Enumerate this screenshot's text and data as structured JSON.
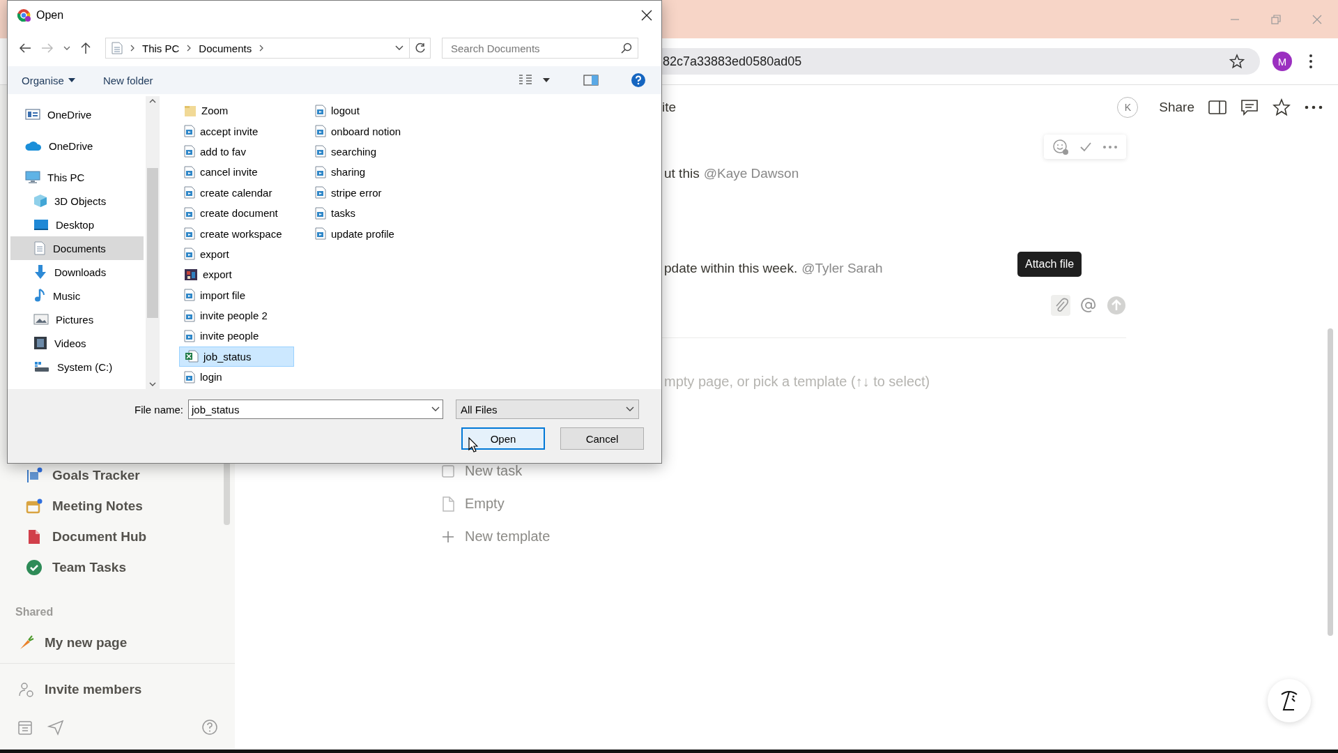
{
  "browser": {
    "address": "82c7a33883ed0580ad05",
    "profile_initial": "M"
  },
  "sidebar": {
    "items": [
      {
        "label": "Goals Tracker",
        "kind": "chart"
      },
      {
        "label": "Meeting Notes",
        "kind": "calendar"
      },
      {
        "label": "Document Hub",
        "kind": "document"
      },
      {
        "label": "Team Tasks",
        "kind": "check"
      }
    ],
    "section_label": "Shared",
    "shared_items": [
      {
        "label": "My new page",
        "kind": "carrot"
      }
    ],
    "invite": "Invite members"
  },
  "page": {
    "title": "ite",
    "avatar_initial": "K",
    "share": "Share",
    "comments": [
      {
        "text": "ut this",
        "mention": "@Kaye Dawson"
      },
      {
        "text": "pdate within this week.",
        "mention": "@Tyler Sarah"
      }
    ],
    "tooltip": "Attach file",
    "prompt": "mpty page, or pick a template (↑↓ to select)",
    "templates": [
      {
        "label": "New task",
        "kind": "task"
      },
      {
        "label": "Empty",
        "kind": "page"
      },
      {
        "label": "New template",
        "kind": "add"
      }
    ]
  },
  "dialog": {
    "title": "Open",
    "path": [
      "This PC",
      "Documents"
    ],
    "search_placeholder": "Search Documents",
    "commands": [
      {
        "label": "Organise",
        "kind": "menu"
      },
      {
        "label": "New folder",
        "kind": "plain"
      }
    ],
    "nav": [
      {
        "label": "OneDrive",
        "kind": "onedrive-business",
        "selected": false
      },
      {
        "label": "OneDrive",
        "kind": "cloud",
        "selected": false
      },
      {
        "label": "This PC",
        "kind": "pc",
        "selected": false,
        "children": [
          {
            "label": "3D Objects",
            "kind": "cube",
            "selected": false
          },
          {
            "label": "Desktop",
            "kind": "desktop",
            "selected": false
          },
          {
            "label": "Documents",
            "kind": "documents",
            "selected": true
          },
          {
            "label": "Downloads",
            "kind": "download",
            "selected": false
          },
          {
            "label": "Music",
            "kind": "music",
            "selected": false
          },
          {
            "label": "Pictures",
            "kind": "pictures",
            "selected": false
          },
          {
            "label": "Videos",
            "kind": "videos",
            "selected": false
          },
          {
            "label": "System (C:)",
            "kind": "drive",
            "selected": false
          }
        ]
      }
    ],
    "files": [
      {
        "name": "Zoom",
        "kind": "folder",
        "selected": false
      },
      {
        "name": "accept invite",
        "kind": "video",
        "selected": false
      },
      {
        "name": "add to fav",
        "kind": "video",
        "selected": false
      },
      {
        "name": "cancel invite",
        "kind": "video",
        "selected": false
      },
      {
        "name": "create calendar",
        "kind": "video",
        "selected": false
      },
      {
        "name": "create document",
        "kind": "video",
        "selected": false
      },
      {
        "name": "create workspace",
        "kind": "video",
        "selected": false
      },
      {
        "name": "export",
        "kind": "video",
        "selected": false
      },
      {
        "name": "export",
        "kind": "image",
        "selected": false
      },
      {
        "name": "import file",
        "kind": "video",
        "selected": false
      },
      {
        "name": "invite people 2",
        "kind": "video",
        "selected": false
      },
      {
        "name": "invite people",
        "kind": "video",
        "selected": false
      },
      {
        "name": "job_status",
        "kind": "spreadsheet",
        "selected": true
      },
      {
        "name": "login",
        "kind": "video",
        "selected": false
      },
      {
        "name": "logout",
        "kind": "video",
        "selected": false
      },
      {
        "name": "onboard notion",
        "kind": "video",
        "selected": false
      },
      {
        "name": "searching",
        "kind": "video",
        "selected": false
      },
      {
        "name": "sharing",
        "kind": "video",
        "selected": false
      },
      {
        "name": "stripe error",
        "kind": "video",
        "selected": false
      },
      {
        "name": "tasks",
        "kind": "video",
        "selected": false
      },
      {
        "name": "update profile",
        "kind": "video",
        "selected": false
      }
    ],
    "file_name_label": "File name:",
    "file_name": "job_status",
    "file_type": "All Files",
    "buttons": [
      {
        "label": "Open",
        "focused": true
      },
      {
        "label": "Cancel",
        "focused": false
      }
    ]
  }
}
